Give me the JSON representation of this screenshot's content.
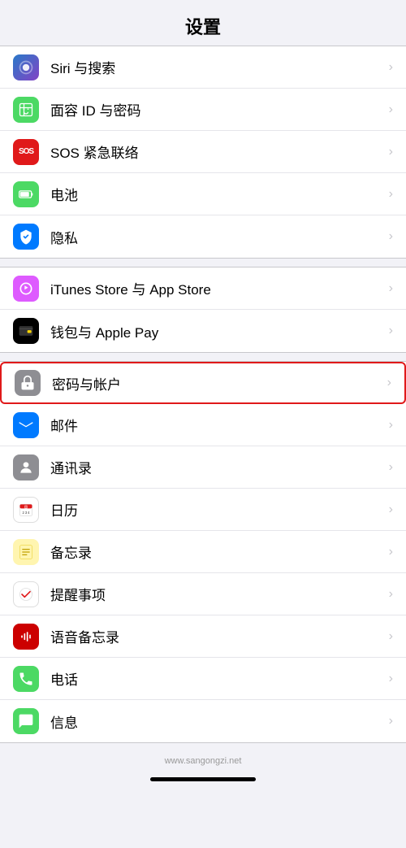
{
  "page": {
    "title": "设置",
    "watermark": "www.sangongzi.net"
  },
  "groups": [
    {
      "id": "group1",
      "items": [
        {
          "id": "siri",
          "label": "Siri 与搜索",
          "icon_type": "siri",
          "icon_class": "icon-siri"
        },
        {
          "id": "faceid",
          "label": "面容 ID 与密码",
          "icon_type": "faceid",
          "icon_class": "icon-faceid"
        },
        {
          "id": "sos",
          "label": "SOS 紧急联络",
          "icon_type": "sos",
          "icon_class": "icon-sos"
        },
        {
          "id": "battery",
          "label": "电池",
          "icon_type": "battery",
          "icon_class": "icon-battery"
        },
        {
          "id": "privacy",
          "label": "隐私",
          "icon_type": "privacy",
          "icon_class": "icon-privacy"
        }
      ]
    },
    {
      "id": "group2",
      "items": [
        {
          "id": "itunes",
          "label": "iTunes Store 与 App Store",
          "icon_type": "itunes",
          "icon_class": "icon-itunes"
        },
        {
          "id": "wallet",
          "label": "钱包与 Apple Pay",
          "icon_type": "wallet",
          "icon_class": "icon-wallet"
        }
      ]
    },
    {
      "id": "group3",
      "items": [
        {
          "id": "passwords",
          "label": "密码与帐户",
          "icon_type": "passwords",
          "icon_class": "icon-passwords",
          "highlighted": true
        },
        {
          "id": "mail",
          "label": "邮件",
          "icon_type": "mail",
          "icon_class": "icon-mail"
        },
        {
          "id": "contacts",
          "label": "通讯录",
          "icon_type": "contacts",
          "icon_class": "icon-contacts"
        },
        {
          "id": "calendar",
          "label": "日历",
          "icon_type": "calendar",
          "icon_class": "icon-calendar"
        },
        {
          "id": "notes",
          "label": "备忘录",
          "icon_type": "notes",
          "icon_class": "icon-notes"
        },
        {
          "id": "reminders",
          "label": "提醒事项",
          "icon_type": "reminders",
          "icon_class": "icon-reminders"
        },
        {
          "id": "voice",
          "label": "语音备忘录",
          "icon_type": "voice",
          "icon_class": "icon-voice"
        },
        {
          "id": "phone",
          "label": "电话",
          "icon_type": "phone",
          "icon_class": "icon-phone"
        },
        {
          "id": "messages",
          "label": "信息",
          "icon_type": "messages",
          "icon_class": "icon-messages"
        }
      ]
    }
  ]
}
